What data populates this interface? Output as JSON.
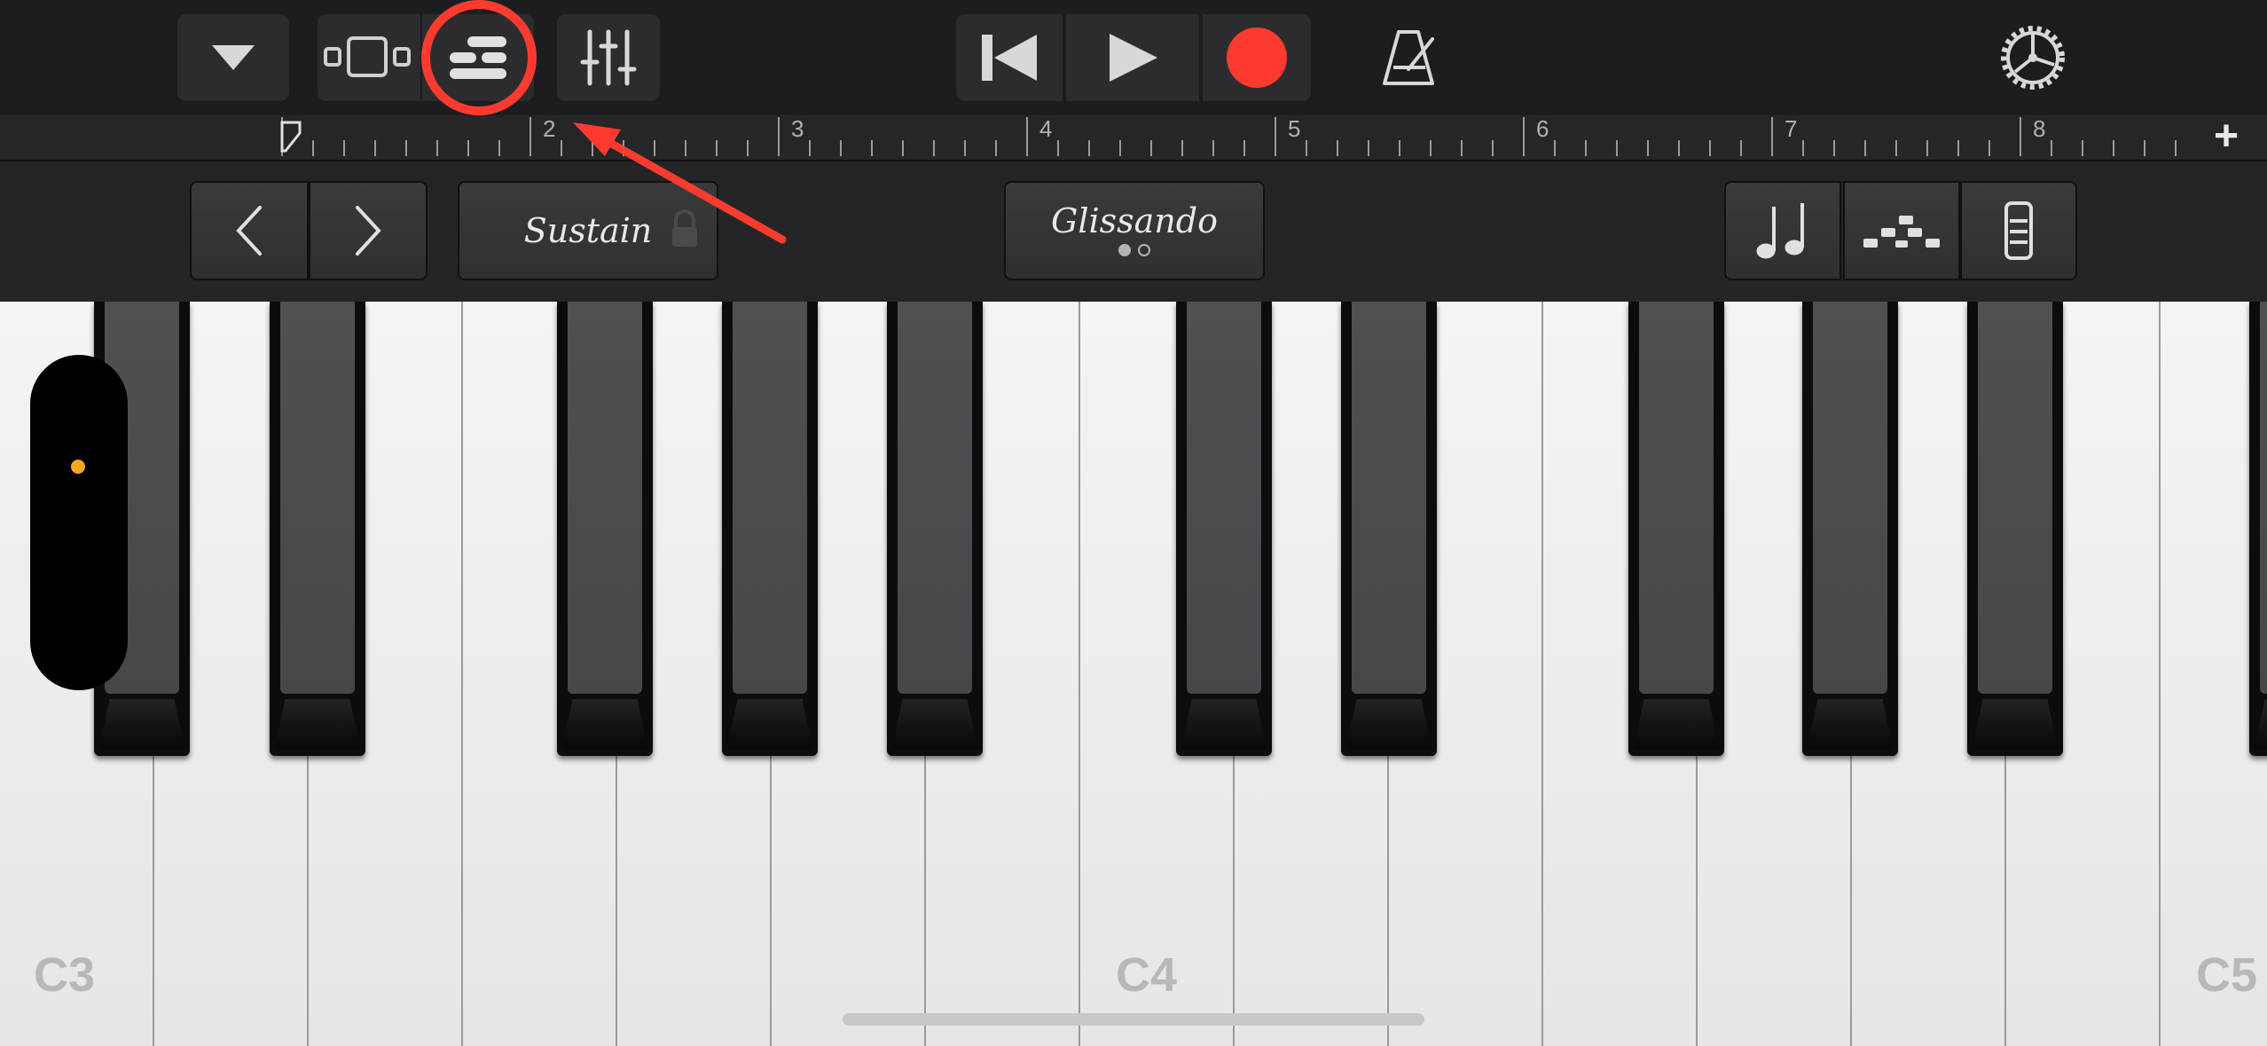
{
  "toolbar": {
    "buttons": [
      "navigation-dropdown",
      "tracks-view",
      "smart-controls",
      "mixer",
      "go-to-beginning",
      "play",
      "record",
      "metronome",
      "settings"
    ]
  },
  "ruler": {
    "bars": [
      "2",
      "3",
      "4",
      "5",
      "6",
      "7",
      "8"
    ],
    "add_label": "+"
  },
  "controls": {
    "sustain_label": "Sustain",
    "glissando_label": "Glissando"
  },
  "keyboard": {
    "labels": [
      "C3",
      "C4",
      "C5"
    ]
  },
  "colors": {
    "record": "#ff3b30",
    "annotation": "#ff3b30",
    "pitch_dot": "#f5a623"
  }
}
